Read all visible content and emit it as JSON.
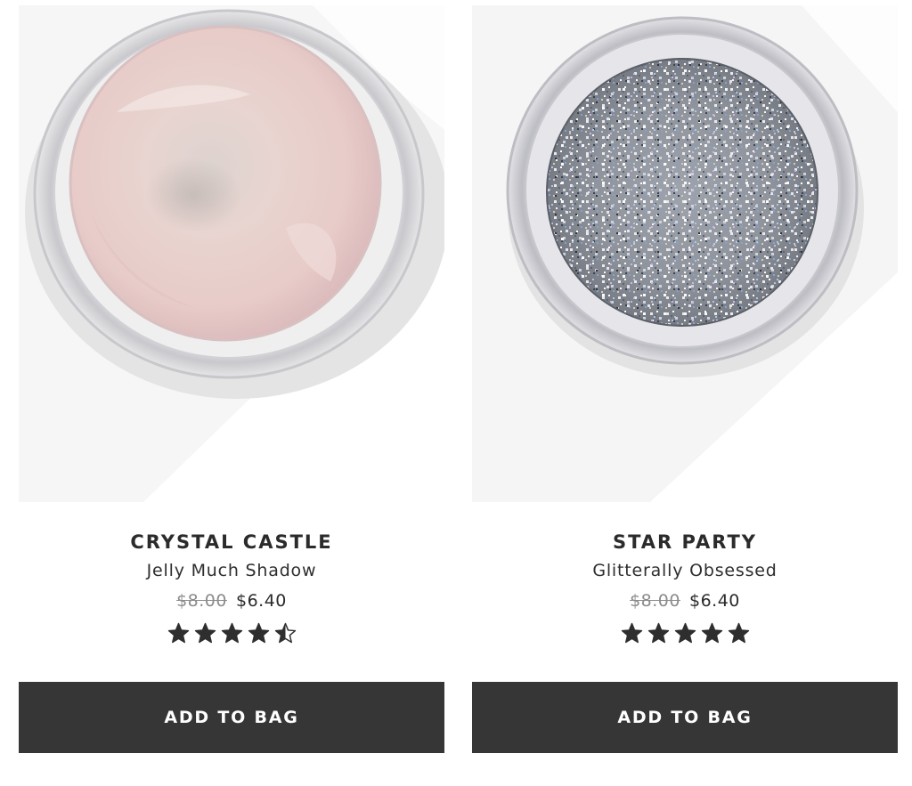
{
  "products": [
    {
      "name": "CRYSTAL CASTLE",
      "subtitle": "Jelly Much Shadow",
      "old_price": "$8.00",
      "price": "$6.40",
      "rating": 4.5,
      "button_label": "ADD TO BAG",
      "image_icon": "pink-jelly-shadow-jar-icon"
    },
    {
      "name": "STAR PARTY",
      "subtitle": "Glitterally Obsessed",
      "old_price": "$8.00",
      "price": "$6.40",
      "rating": 5,
      "button_label": "ADD TO BAG",
      "image_icon": "silver-glitter-jar-icon"
    }
  ],
  "colors": {
    "button_bg": "#363636",
    "button_text": "#ffffff",
    "star": "#2e2e2e",
    "old_price": "#8c8c8c"
  }
}
